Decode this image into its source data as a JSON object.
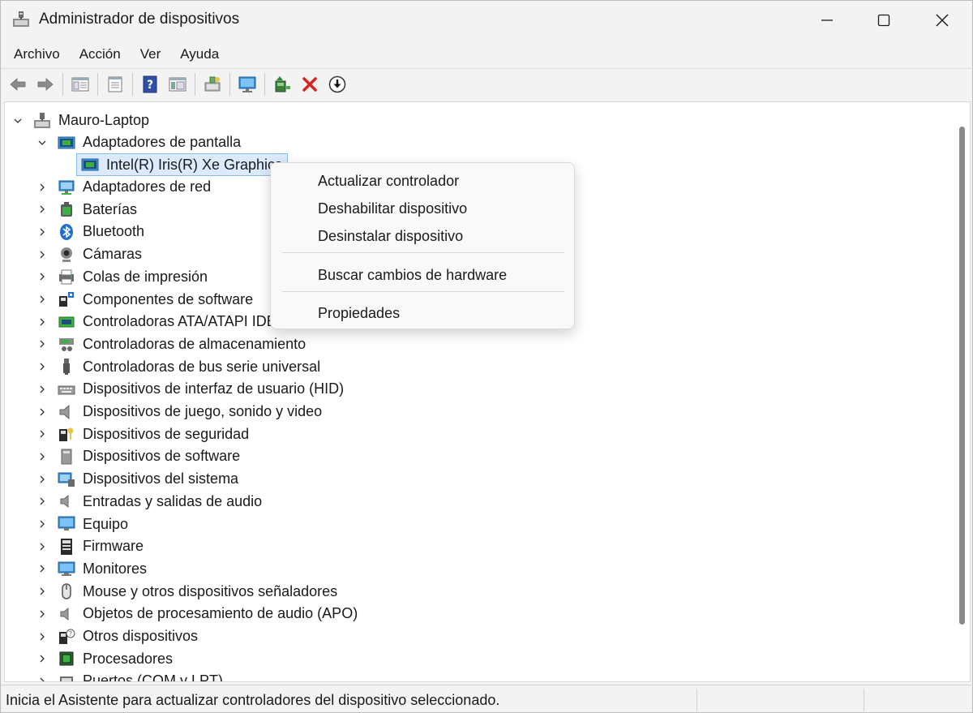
{
  "window": {
    "title": "Administrador de dispositivos"
  },
  "menu": [
    "Archivo",
    "Acción",
    "Ver",
    "Ayuda"
  ],
  "toolbar": {
    "icons": [
      "back-arrow-icon",
      "forward-arrow-icon",
      "show-hide-tree-icon",
      "properties-sheet-icon",
      "help-icon",
      "action-pane-icon",
      "scan-hardware-icon",
      "monitor-icon",
      "update-driver-icon",
      "uninstall-x-icon",
      "download-circle-icon"
    ]
  },
  "tree": {
    "root": "Mauro-Laptop",
    "expanded_category": "Adaptadores de pantalla",
    "selected_device": "Intel(R) Iris(R) Xe Graphics",
    "categories": [
      "Adaptadores de red",
      "Baterías",
      "Bluetooth",
      "Cámaras",
      "Colas de impresión",
      "Componentes de software",
      "Controladoras ATA/ATAPI IDE",
      "Controladoras de almacenamiento",
      "Controladoras de bus serie universal",
      "Dispositivos de interfaz de usuario (HID)",
      "Dispositivos de juego, sonido y video",
      "Dispositivos de seguridad",
      "Dispositivos de software",
      "Dispositivos del sistema",
      "Entradas y salidas de audio",
      "Equipo",
      "Firmware",
      "Monitores",
      "Mouse y otros dispositivos señaladores",
      "Objetos de procesamiento de audio (APO)",
      "Otros dispositivos",
      "Procesadores",
      "Puertos (COM y LPT)"
    ]
  },
  "context_menu": {
    "update_driver": "Actualizar controlador",
    "disable_device": "Deshabilitar dispositivo",
    "uninstall_device": "Desinstalar dispositivo",
    "scan_hardware": "Buscar cambios de hardware",
    "properties": "Propiedades"
  },
  "statusbar": {
    "text": "Inicia el Asistente para actualizar controladores del dispositivo seleccionado."
  }
}
